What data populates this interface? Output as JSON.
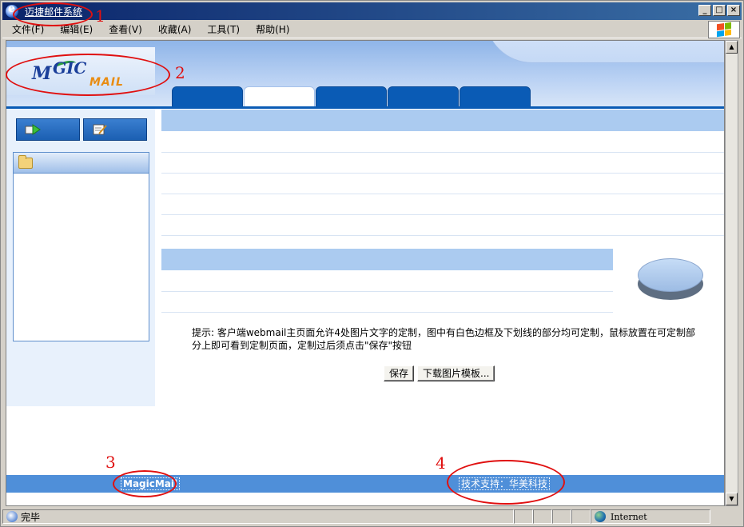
{
  "window": {
    "title": "迈捷邮件系统",
    "controls": [
      "_",
      "□",
      "×"
    ]
  },
  "menu": {
    "items": [
      "文件(F)",
      "编辑(E)",
      "查看(V)",
      "收藏(A)",
      "工具(T)",
      "帮助(H)"
    ]
  },
  "logo": {
    "m": "M",
    "gic": "GIC",
    "mail": "MAIL"
  },
  "tabs": [
    {
      "label": "",
      "active": false
    },
    {
      "label": "",
      "active": true
    },
    {
      "label": "",
      "active": false
    },
    {
      "label": "",
      "active": false
    },
    {
      "label": "",
      "active": false
    }
  ],
  "content": {
    "hint": "提示: 客户端webmail主页面允许4处图片文字的定制，图中有白色边框及下划线的部分均可定制，鼠标放置在可定制部分上即可看到定制页面，定制过后须点击\"保存\"按钮",
    "save_label": "保存",
    "download_label": "下载图片模板..."
  },
  "footer": {
    "left_text": "MagicMail",
    "right_text": "技术支持：华美科技"
  },
  "annotations": {
    "n1": "1",
    "n2": "2",
    "n3": "3",
    "n4": "4"
  },
  "status": {
    "text": "完毕",
    "zone": "Internet"
  },
  "colors": {
    "annotation": "#e01010",
    "tab_blue": "#0a5bb5",
    "footer_blue": "#4f8fd9"
  }
}
